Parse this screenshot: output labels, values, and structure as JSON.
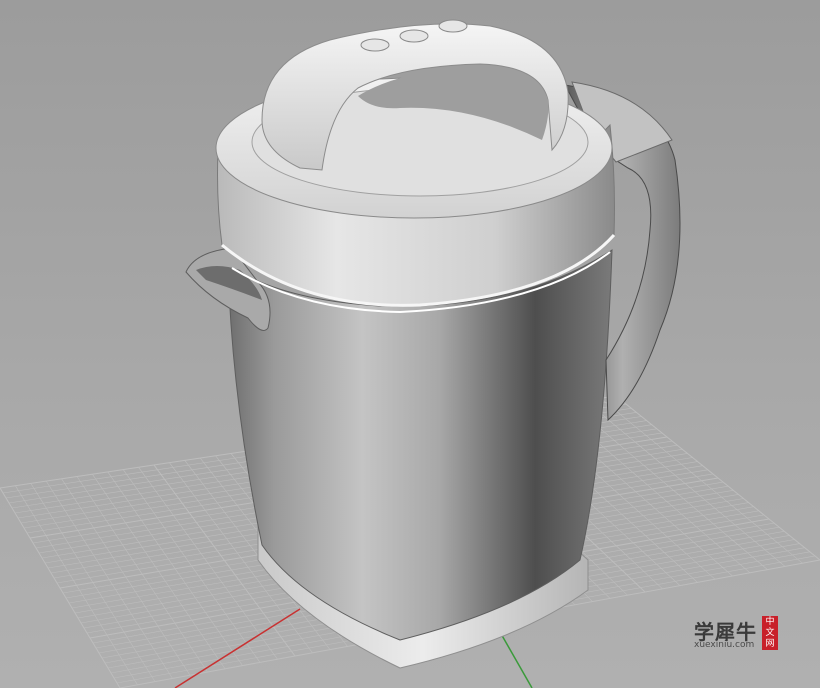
{
  "viewport": {
    "view": "perspective",
    "background_color": "#a5a5a5",
    "grid_color": "#bdbdbd",
    "x_axis_color": "#c83232",
    "y_axis_color": "#3a9a3a"
  },
  "model": {
    "object": "kettle",
    "lid_buttons": 3,
    "shading": "rendered",
    "color": "#d8d8d8"
  },
  "watermark": {
    "cn_text": "学犀牛",
    "en_text": "xuexiniu.com",
    "seal_chars": [
      "中",
      "文",
      "网"
    ],
    "seal_color": "#c8202a"
  }
}
